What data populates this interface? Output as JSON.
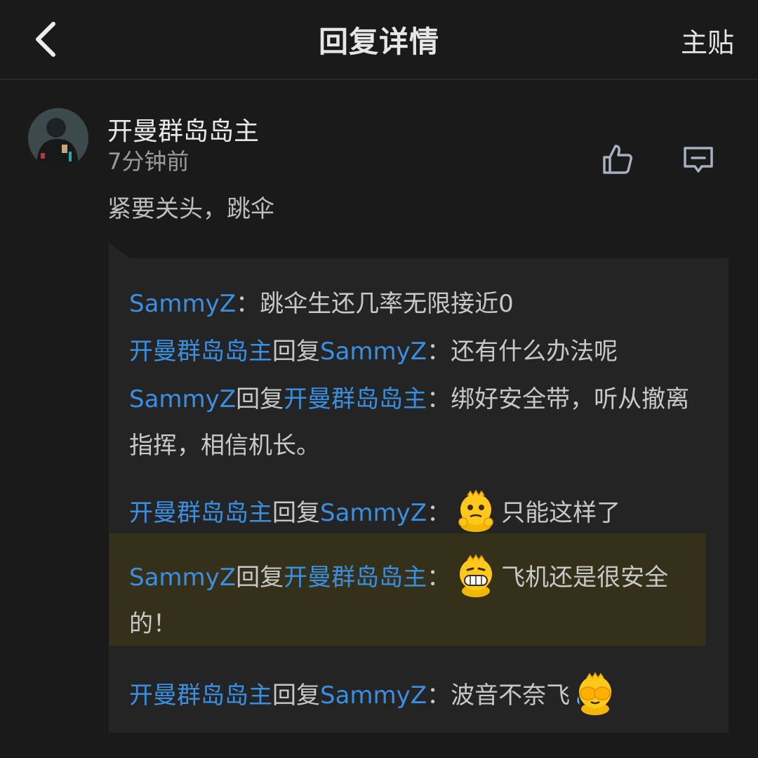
{
  "header": {
    "back_icon": "chevron-left-icon",
    "title": "回复详情",
    "main_post_label": "主贴"
  },
  "comment": {
    "avatar_icon": "user-avatar",
    "author": "开曼群岛岛主",
    "time": "7分钟前",
    "like_icon": "thumbs-up-icon",
    "reply_icon": "comment-icon",
    "text": "紧要关头，跳伞"
  },
  "replies": [
    {
      "from": "SammyZ",
      "connector": "",
      "to": "",
      "colon": "：",
      "text": "跳伞生还几率无限接近0",
      "emoji": ""
    },
    {
      "from": "开曼群岛岛主",
      "connector": "回复",
      "to": "SammyZ",
      "colon": "：",
      "text": "还有什么办法呢",
      "emoji": ""
    },
    {
      "from": "SammyZ",
      "connector": "回复",
      "to": "开曼群岛岛主",
      "colon": "：",
      "text": "绑好安全带，听从撤离指挥，相信机长。",
      "emoji": ""
    },
    {
      "from": "开曼群岛岛主",
      "connector": "回复",
      "to": "SammyZ",
      "colon": "：",
      "text": "只能这样了",
      "emoji": "bear-thinking-emoji",
      "emoji_pos": "before"
    },
    {
      "from": "SammyZ",
      "connector": "回复",
      "to": "开曼群岛岛主",
      "colon": "：",
      "text": "飞机还是很安全的！",
      "emoji": "bear-grin-emoji",
      "emoji_pos": "before",
      "highlighted": true
    },
    {
      "from": "开曼群岛岛主",
      "connector": "回复",
      "to": "SammyZ",
      "colon": "：",
      "text": "波音不奈飞",
      "emoji": "bear-facepalm-emoji",
      "emoji_pos": "after"
    }
  ],
  "colors": {
    "background": "#1a1a1a",
    "reply_box": "#242424",
    "highlight": "#343019",
    "username_link": "#3b8fe0"
  }
}
